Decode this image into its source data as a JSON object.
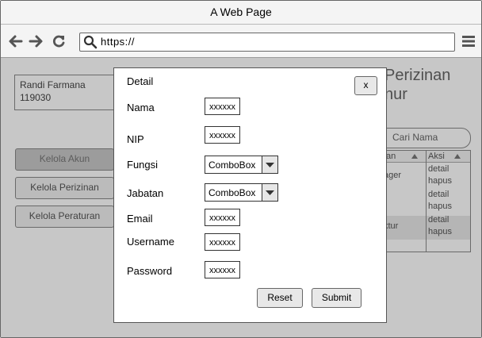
{
  "window": {
    "title": "A Web Page"
  },
  "browser": {
    "url": "https://"
  },
  "sidebar": {
    "user_name": "Randi Farmana",
    "user_id": "119030",
    "items": [
      {
        "label": "Kelola Akun",
        "active": true
      },
      {
        "label": "Kelola Perizinan",
        "active": false
      },
      {
        "label": "Kelola Peraturan",
        "active": false
      }
    ]
  },
  "main": {
    "title_line1": "Perizinan",
    "title_line2": "nur",
    "search_placeholder": "Cari Nama",
    "table": {
      "col1_header": "tan",
      "col2_header": "Aksi",
      "col1_cells": [
        "ager",
        "ktur"
      ],
      "action_detail": "detail",
      "action_delete": "hapus"
    }
  },
  "modal": {
    "heading": "Detail",
    "close_label": "x",
    "fields": [
      {
        "label": "Nama",
        "type": "text",
        "value": "xxxxxx"
      },
      {
        "label": "NIP",
        "type": "text",
        "value": "xxxxxx"
      },
      {
        "label": "Fungsi",
        "type": "combo",
        "value": "ComboBox"
      },
      {
        "label": "Jabatan",
        "type": "combo",
        "value": "ComboBox"
      },
      {
        "label": "Email",
        "type": "text",
        "value": "xxxxxx"
      },
      {
        "label": "Username",
        "type": "text",
        "value": "xxxxxx"
      },
      {
        "label": "Password",
        "type": "text",
        "value": "xxxxxx"
      }
    ],
    "reset_label": "Reset",
    "submit_label": "Submit"
  },
  "colors": {
    "overlay": "#000000",
    "button_bg": "#e8e8e8",
    "active_nav": "#c8c8c8"
  }
}
